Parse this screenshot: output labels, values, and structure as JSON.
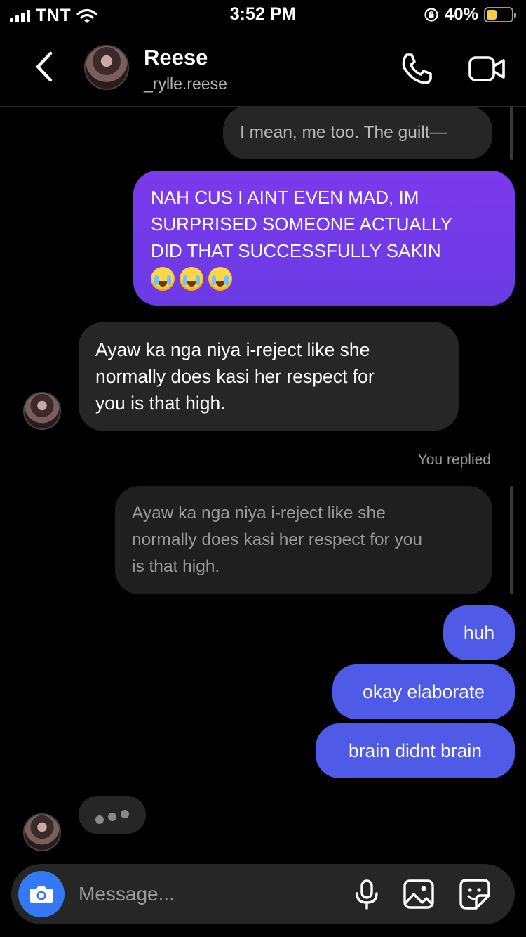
{
  "status_bar": {
    "carrier": "TNT",
    "time": "3:52 PM",
    "battery_percent": "40%",
    "battery_level": 0.4
  },
  "header": {
    "name": "Reese",
    "handle": "_rylle.reese",
    "back_icon": "chevron-left-icon",
    "call_icon": "phone-icon",
    "video_icon": "video-camera-icon"
  },
  "messages": {
    "m1": "I mean, me too. The guilt—",
    "m2_lines": [
      "NAH CUS I AINT EVEN MAD, IM",
      "SURPRISED SOMEONE ACTUALLY",
      "DID THAT SUCCESSFULLY SAKIN"
    ],
    "m2_emoji": "crying-face-emoji",
    "m3_lines": [
      "Ayaw ka nga niya i-reject like she",
      "normally does kasi her respect for",
      "you is that high."
    ],
    "you_replied": "You replied",
    "quote_lines": [
      "Ayaw ka nga niya i-reject like she",
      "normally does kasi her respect for you",
      "is that high."
    ],
    "m4": "huh",
    "m5": "okay elaborate",
    "m6": "brain didnt brain"
  },
  "composer": {
    "placeholder": "Message...",
    "camera_icon": "camera-icon",
    "mic_icon": "microphone-icon",
    "gallery_icon": "image-icon",
    "sticker_icon": "sticker-icon"
  },
  "colors": {
    "incoming": "#262626",
    "outgoing_purple": "#7c3aed",
    "outgoing_blue": "#4f5be6",
    "camera": "#3478f6"
  }
}
